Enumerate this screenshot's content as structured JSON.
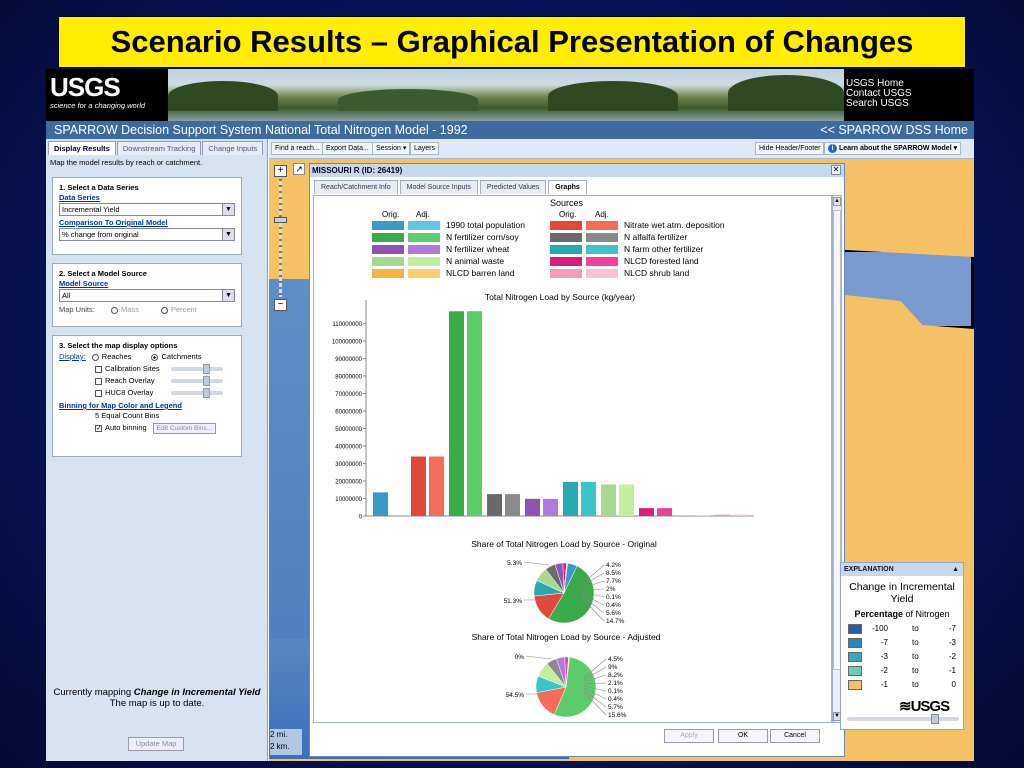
{
  "slide_title": "Scenario Results – Graphical Presentation of Changes",
  "banner": {
    "logo_text": "USGS",
    "logo_tagline": "science for a changing world",
    "links": [
      "USGS Home",
      "Contact USGS",
      "Search USGS"
    ]
  },
  "system_bar": {
    "title": "SPARROW Decision Support System National Total Nitrogen Model - 1992",
    "home_link": "<< SPARROW DSS Home"
  },
  "left_panel": {
    "tabs": [
      "Display Results",
      "Downstream Tracking",
      "Change Inputs"
    ],
    "active_tab": "Display Results",
    "description": "Map the model results by reach or catchment.",
    "section1": {
      "heading": "1. Select a Data Series",
      "data_series_link": "Data Series",
      "data_series_value": "Incremental Yield",
      "comparison_link": "Comparison To Original Model",
      "comparison_value": "% change from original"
    },
    "section2": {
      "heading": "2. Select a Model Source",
      "model_source_link": "Model Source",
      "model_source_value": "All",
      "map_units_label": "Map Units:",
      "map_units_mass": "Mass",
      "map_units_percent": "Percent"
    },
    "section3": {
      "heading": "3. Select the map display options",
      "display_label": "Display:",
      "reaches": "Reaches",
      "catchments": "Catchments",
      "calibration_sites": "Calibration Sites",
      "reach_overlay": "Reach Overlay",
      "huc8_overlay": "HUC8 Overlay",
      "binning_link": "Binning for Map Color and Legend",
      "bins_text": "5 Equal Count Bins",
      "auto_binning": "Auto binning",
      "edit_bins": "Edit Custom Bins..."
    },
    "status_prefix": "Currently mapping",
    "status_value": "Change in Incremental Yield",
    "status_suffix": "The map is up to date.",
    "update_button": "Update Map"
  },
  "toolbar": {
    "find_reach": "Find a reach...",
    "export_data": "Export Data...",
    "session": "Session ▾",
    "layers": "Layers",
    "hide_header": "Hide Header/Footer",
    "learn_about": "Learn about the SPARROW Model ▾"
  },
  "map": {
    "scale_mi": "2 mi.",
    "scale_km": "2 km."
  },
  "popup": {
    "title": "MISSOURI R (ID: 26419)",
    "tabs": [
      "Reach/Catchment Info",
      "Model Source Inputs",
      "Predicted Values",
      "Graphs"
    ],
    "active_tab": "Graphs",
    "footer_buttons": [
      "Apply",
      "OK",
      "Cancel"
    ]
  },
  "legend": {
    "title": "Sources",
    "col_orig": "Orig.",
    "col_adj": "Adj.",
    "items": [
      {
        "label": "1990 total population",
        "orig_color": "#3c98c8",
        "adj_color": "#62c4e8"
      },
      {
        "label": "N fertilizer corn/soy",
        "orig_color": "#3aaa4a",
        "adj_color": "#5ccb6c"
      },
      {
        "label": "N fertilizer wheat",
        "orig_color": "#8e54b0",
        "adj_color": "#b27ad8"
      },
      {
        "label": "N animal waste",
        "orig_color": "#a8d890",
        "adj_color": "#c4ee9e"
      },
      {
        "label": "NLCD barren land",
        "orig_color": "#f4b448",
        "adj_color": "#fccc70"
      },
      {
        "label": "Nitrate wet atm. deposition",
        "orig_color": "#e0483a",
        "adj_color": "#f46c5a"
      },
      {
        "label": "N alfalfa fertilizer",
        "orig_color": "#6a6a6a",
        "adj_color": "#8a8a8a"
      },
      {
        "label": "N farm other fertilizer",
        "orig_color": "#2aa8b0",
        "adj_color": "#3cc4c8"
      },
      {
        "label": "NLCD forested land",
        "orig_color": "#d81e7a",
        "adj_color": "#f0409a"
      },
      {
        "label": "NLCD shrub land",
        "orig_color": "#f29cba",
        "adj_color": "#f8c0d4"
      }
    ]
  },
  "chart_data": [
    {
      "type": "bar",
      "title": "Total Nitrogen Load by Source (kg/year)",
      "categories": [
        "1990 total population",
        "Nitrate wet atm. deposition",
        "N fertilizer corn/soy",
        "N alfalfa fertilizer",
        "N fertilizer wheat",
        "N farm other fertilizer",
        "N animal waste",
        "NLCD forested land",
        "NLCD barren land",
        "NLCD shrub land"
      ],
      "series": [
        {
          "name": "Orig.",
          "values": [
            13500000,
            34000000,
            117000000,
            12500000,
            9800000,
            19500000,
            18000000,
            4500000,
            400000,
            800000
          ]
        },
        {
          "name": "Adj.",
          "values": [
            0,
            34000000,
            117000000,
            12500000,
            9800000,
            19500000,
            18000000,
            4500000,
            400000,
            800000
          ]
        }
      ],
      "ylim": [
        0,
        120000000
      ],
      "yticks": [
        0,
        10000000,
        20000000,
        30000000,
        40000000,
        50000000,
        60000000,
        70000000,
        80000000,
        90000000,
        100000000,
        110000000
      ],
      "ytick_labels": [
        "0",
        "10000000",
        "20000000",
        "30000000",
        "40000000",
        "50000000",
        "60000000",
        "70000000",
        "80000000",
        "90000000",
        "100000000",
        "110000000"
      ]
    },
    {
      "type": "pie",
      "title": "Share of Total Nitrogen Load by Source - Original",
      "labels": [
        "1990 total population",
        "N fertilizer corn/soy",
        "Nitrate wet atm. deposition",
        "N farm other fertilizer",
        "N animal waste",
        "N alfalfa fertilizer",
        "N fertilizer wheat",
        "NLCD forested land",
        "NLCD barren land",
        "NLCD shrub land"
      ],
      "values": [
        5.3,
        51.3,
        14.7,
        8.5,
        7.7,
        5.6,
        4.2,
        2,
        0.1,
        0.4
      ],
      "value_labels": [
        "5.3%",
        "51.3%",
        "14.7%",
        "8.5%",
        "7.7%",
        "5.6%",
        "4.2%",
        "2%",
        "0.1%",
        "0.4%"
      ]
    },
    {
      "type": "pie",
      "title": "Share of Total Nitrogen Load by Source - Adjusted",
      "labels": [
        "1990 total population",
        "N fertilizer corn/soy",
        "Nitrate wet atm. deposition",
        "N farm other fertilizer",
        "N animal waste",
        "N alfalfa fertilizer",
        "N fertilizer wheat",
        "NLCD forested land",
        "NLCD barren land",
        "NLCD shrub land"
      ],
      "values": [
        0,
        54.5,
        15.6,
        9,
        8.2,
        5.7,
        4.5,
        2.1,
        0.1,
        0.4
      ],
      "value_labels": [
        "0%",
        "54.5%",
        "15.6%",
        "9%",
        "8.2%",
        "5.7%",
        "4.5%",
        "2.1%",
        "0.1%",
        "0.4%"
      ]
    }
  ],
  "explanation": {
    "header": "EXPLANATION",
    "title": "Change in Incremental Yield",
    "subtitle_bold": "Percentage",
    "subtitle_rest": "of Nitrogen",
    "bins": [
      {
        "from": "-100",
        "to_word": "to",
        "to": "-7",
        "color": "#2b5aa8"
      },
      {
        "from": "-7",
        "to_word": "to",
        "to": "-3",
        "color": "#2c86bc"
      },
      {
        "from": "-3",
        "to_word": "to",
        "to": "-2",
        "color": "#3aa6bc"
      },
      {
        "from": "-2",
        "to_word": "to",
        "to": "-1",
        "color": "#6ccab8"
      },
      {
        "from": "-1",
        "to_word": "to",
        "to": "0",
        "color": "#f4c264"
      }
    ],
    "logo": "≋USGS"
  }
}
